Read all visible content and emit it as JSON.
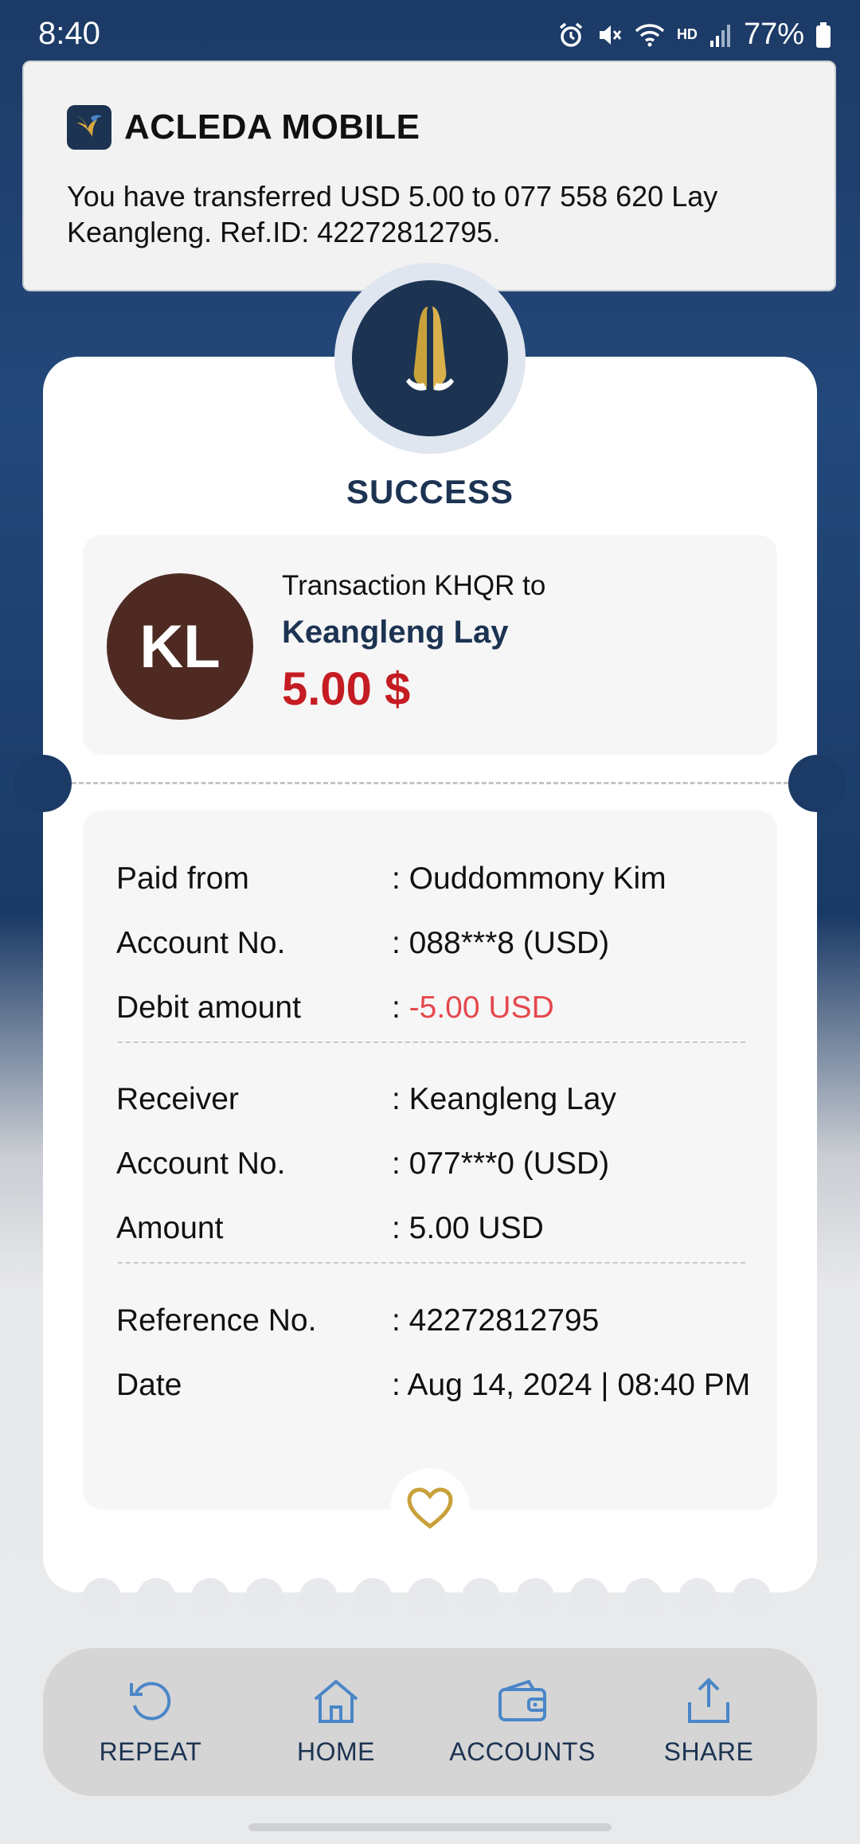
{
  "status_bar": {
    "time": "8:40",
    "network": "HD",
    "battery": "77%"
  },
  "notification": {
    "app_name": "ACLEDA MOBILE",
    "message": "You have transferred USD 5.00 to 077 558 620 Lay Keangleng. Ref.ID: 42272812795."
  },
  "receipt": {
    "status": "SUCCESS",
    "avatar_initials": "KL",
    "transaction_label": "Transaction KHQR to",
    "recipient_name": "Keangleng Lay",
    "amount": "5.00 $",
    "details": {
      "paid_from": {
        "label": "Paid from",
        "value": ": Ouddommony Kim"
      },
      "from_account": {
        "label": "Account No.",
        "value": ": 088***8 (USD)"
      },
      "debit_amount": {
        "label": "Debit amount",
        "prefix": ": ",
        "value": "-5.00 USD"
      },
      "receiver": {
        "label": "Receiver",
        "value": ": Keangleng Lay"
      },
      "to_account": {
        "label": "Account No.",
        "value": ": 077***0 (USD)"
      },
      "amount": {
        "label": "Amount",
        "value": ": 5.00 USD"
      },
      "reference": {
        "label": "Reference No.",
        "value": ": 42272812795"
      },
      "date": {
        "label": "Date",
        "value": ": Aug 14, 2024 | 08:40 PM"
      }
    }
  },
  "actions": {
    "repeat": "REPEAT",
    "home": "HOME",
    "accounts": "ACCOUNTS",
    "share": "SHARE"
  },
  "colors": {
    "navy": "#1c3352",
    "amount_red": "#c41c22",
    "debit_red": "#e5484d",
    "gold": "#c9a13b",
    "icon_blue": "#4a86c8"
  },
  "icons": [
    "alarm-icon",
    "mute-icon",
    "wifi-icon",
    "signal-icon",
    "battery-icon",
    "acleda-logo-icon",
    "praying-hands-icon",
    "heart-icon",
    "repeat-icon",
    "home-icon",
    "wallet-icon",
    "share-icon"
  ]
}
